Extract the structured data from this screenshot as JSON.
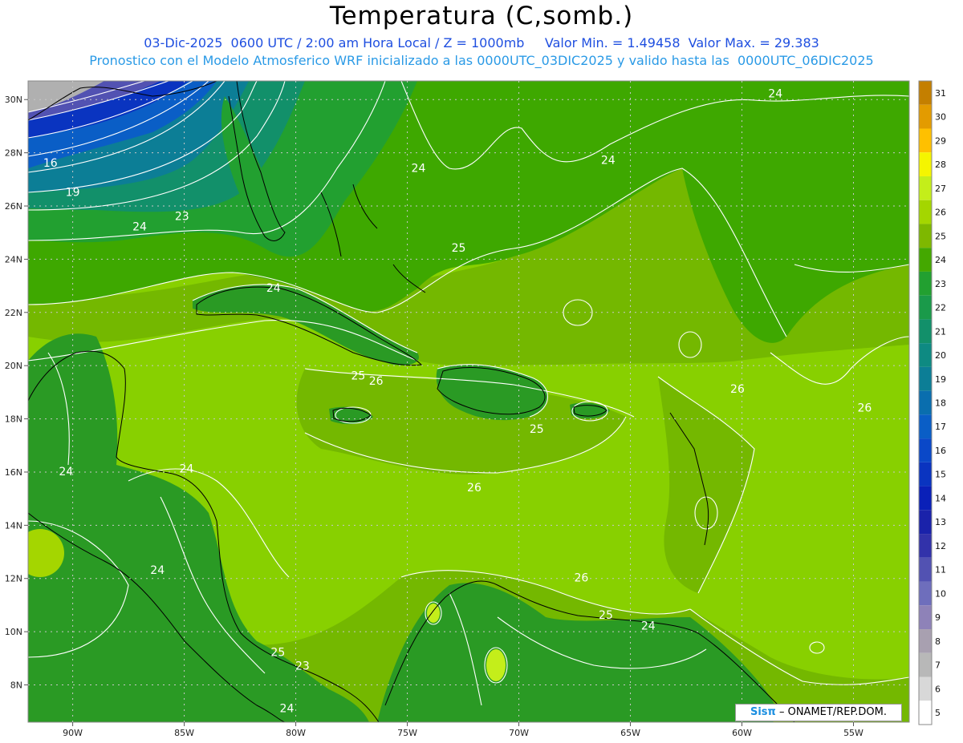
{
  "header": {
    "title": "Temperatura (C,somb.)",
    "line1": "03-Dic-2025  0600 UTC / 2:00 am Hora Local / Z = 1000mb     Valor Min. = 1.49458  Valor Max. = 29.383",
    "line2": "Pronostico con el Modelo Atmosferico WRF inicializado a las 0000UTC_03DIC2025 y valido hasta las  0000UTC_06DIC2025"
  },
  "map": {
    "lat_labels": [
      "30N",
      "28N",
      "26N",
      "24N",
      "22N",
      "20N",
      "18N",
      "16N",
      "14N",
      "12N",
      "10N",
      "8N"
    ],
    "lon_labels": [
      "90W",
      "85W",
      "80W",
      "75W",
      "70W",
      "65W",
      "60W",
      "55W"
    ],
    "contour_labels": [
      {
        "text": "24",
        "lon": -58.5,
        "lat": 30.2
      },
      {
        "text": "16",
        "lon": -91.0,
        "lat": 27.6
      },
      {
        "text": "19",
        "lon": -90.0,
        "lat": 26.5
      },
      {
        "text": "23",
        "lon": -85.1,
        "lat": 25.6
      },
      {
        "text": "24",
        "lon": -87.0,
        "lat": 25.2
      },
      {
        "text": "24",
        "lon": -74.5,
        "lat": 27.4
      },
      {
        "text": "24",
        "lon": -66.0,
        "lat": 27.7
      },
      {
        "text": "25",
        "lon": -72.7,
        "lat": 24.4
      },
      {
        "text": "24",
        "lon": -81.0,
        "lat": 22.9
      },
      {
        "text": "25",
        "lon": -77.2,
        "lat": 19.6
      },
      {
        "text": "26",
        "lon": -76.4,
        "lat": 19.4
      },
      {
        "text": "26",
        "lon": -60.2,
        "lat": 19.1
      },
      {
        "text": "26",
        "lon": -54.5,
        "lat": 18.4
      },
      {
        "text": "25",
        "lon": -69.2,
        "lat": 17.6
      },
      {
        "text": "24",
        "lon": -90.3,
        "lat": 16.0
      },
      {
        "text": "24",
        "lon": -84.9,
        "lat": 16.1
      },
      {
        "text": "26",
        "lon": -72.0,
        "lat": 15.4
      },
      {
        "text": "24",
        "lon": -86.2,
        "lat": 12.3
      },
      {
        "text": "26",
        "lon": -67.2,
        "lat": 12.0
      },
      {
        "text": "25",
        "lon": -66.1,
        "lat": 10.6
      },
      {
        "text": "24",
        "lon": -64.2,
        "lat": 10.2
      },
      {
        "text": "25",
        "lon": -80.8,
        "lat": 9.2
      },
      {
        "text": "23",
        "lon": -79.7,
        "lat": 8.7
      },
      {
        "text": "24",
        "lon": -80.4,
        "lat": 7.1
      }
    ]
  },
  "colorbar": {
    "levels": [
      "31",
      "30",
      "29",
      "28",
      "27",
      "26",
      "25",
      "24",
      "23",
      "22",
      "21",
      "20",
      "19",
      "18",
      "17",
      "16",
      "15",
      "14",
      "13",
      "12",
      "11",
      "10",
      "9",
      "8",
      "7",
      "6",
      "5"
    ],
    "colors": [
      "#c47f00",
      "#e39b00",
      "#ffc000",
      "#f5f500",
      "#c4ee1a",
      "#a4d600",
      "#7eb800",
      "#44a800",
      "#22a030",
      "#1a9a4a",
      "#12906a",
      "#0e8a82",
      "#0c7e96",
      "#0a6eae",
      "#0a5ec6",
      "#0a48c8",
      "#0a34c0",
      "#0a20b8",
      "#1a22aa",
      "#3232aa",
      "#5252b2",
      "#6e6ebc",
      "#8e82b8",
      "#a8a0b0",
      "#b8b8b8",
      "#d8d8d8",
      "#ffffff"
    ]
  },
  "credit": {
    "brand": "Sisπ",
    "text": "– ONAMET/REP.DOM."
  }
}
